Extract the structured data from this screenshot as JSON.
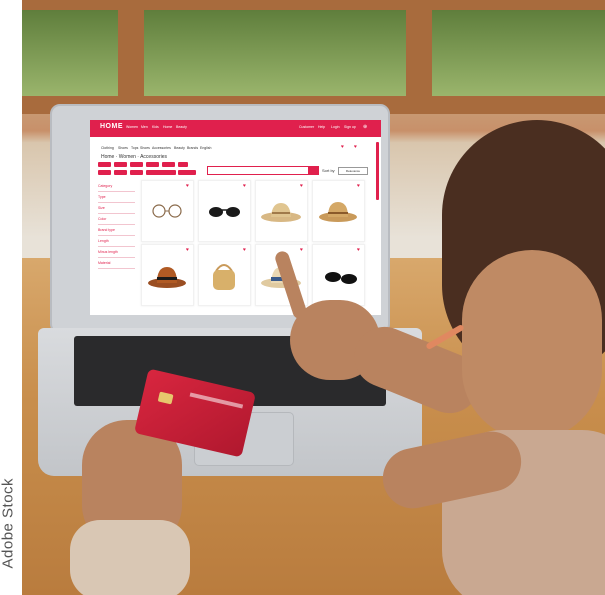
{
  "watermark": "Adobe Stock",
  "website": {
    "brand": "HOME",
    "nav_links": [
      "Women",
      "Men",
      "Kids",
      "Home",
      "Beauty"
    ],
    "account_links": [
      "Customer",
      "Help",
      "Login",
      "Sign up"
    ],
    "categories": [
      "Clothing",
      "Shoes",
      "Tops",
      "Shoes",
      "Accessories",
      "Beauty",
      "Brands",
      "English"
    ],
    "breadcrumb": "Home · Women · Accessories",
    "sort_label": "Sort by",
    "sort_value": "Relevance",
    "filters": [
      "Category",
      "Type",
      "Size",
      "Color",
      "Brand type",
      "Length",
      "Minus length",
      "Material"
    ],
    "products": [
      {
        "name": "glasses"
      },
      {
        "name": "sunglasses"
      },
      {
        "name": "straw hat"
      },
      {
        "name": "straw hat"
      },
      {
        "name": "brown hat"
      },
      {
        "name": "straw bag"
      },
      {
        "name": "straw hat with scarf"
      },
      {
        "name": "sunglasses"
      }
    ]
  },
  "colors": {
    "accent": "#e0204d",
    "card": "#c41e3a"
  }
}
